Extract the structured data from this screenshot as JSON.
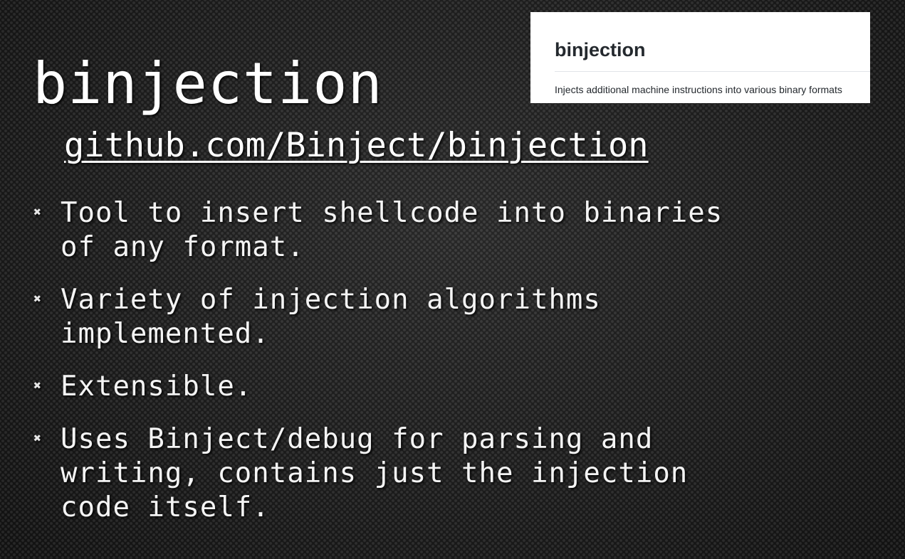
{
  "slide": {
    "title": "binjection",
    "link": "github.com/Binject/binjection",
    "bullet_glyph": "✖",
    "bullets": [
      "Tool to insert shellcode into binaries\nof any format.",
      "Variety of injection algorithms\nimplemented.",
      "Extensible.",
      "Uses Binject/debug for parsing and\nwriting, contains just the injection\ncode itself."
    ]
  },
  "repo_card": {
    "title": "binjection",
    "description": "Injects additional machine instructions into various binary formats"
  },
  "colors": {
    "background": "#1b1b1b",
    "text": "#f2f2f2",
    "card_background": "#ffffff",
    "card_text": "#24292e"
  }
}
